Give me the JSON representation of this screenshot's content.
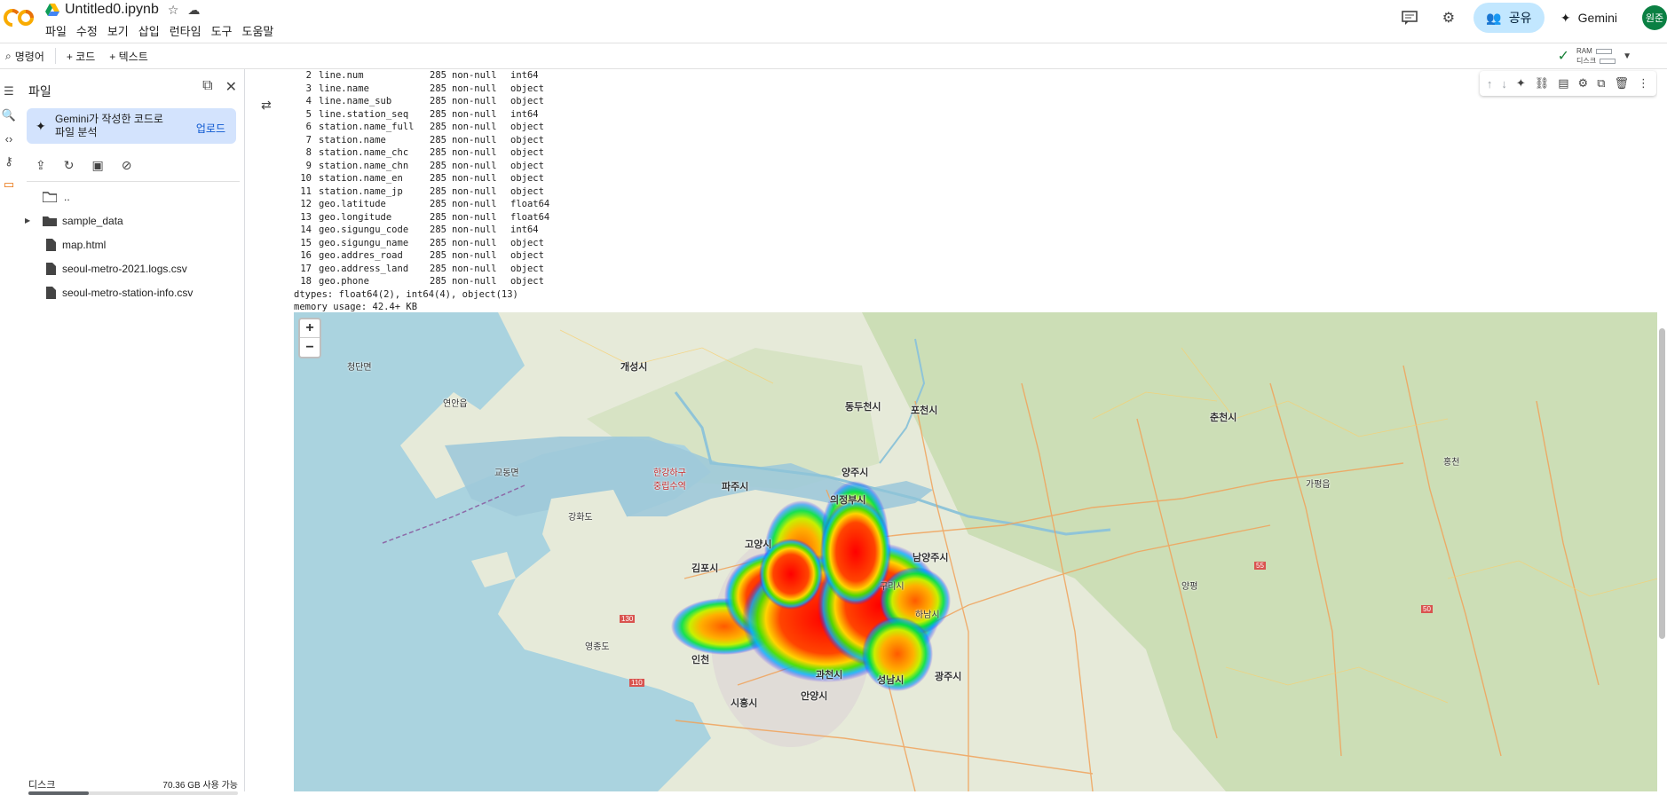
{
  "app": {
    "notebook_title": "Untitled0.ipynb",
    "menu": [
      "파일",
      "수정",
      "보기",
      "삽입",
      "런타임",
      "도구",
      "도움말"
    ],
    "share_label": "공유",
    "gemini_label": "Gemini",
    "avatar_text": "원준"
  },
  "toolbar": {
    "command_label": "명령어",
    "add_code_label": "+ 코드",
    "add_text_label": "+ 텍스트",
    "ram_label": "RAM",
    "disk_label": "디스크"
  },
  "sidebar": {
    "title": "파일",
    "gemini_card_text": "Gemini가 작성한 코드로 파일 분석",
    "gemini_card_action": "업로드",
    "tree": [
      {
        "label": "..",
        "type": "folder-up"
      },
      {
        "label": "sample_data",
        "type": "folder"
      },
      {
        "label": "map.html",
        "type": "file"
      },
      {
        "label": "seoul-metro-2021.logs.csv",
        "type": "file"
      },
      {
        "label": "seoul-metro-station-info.csv",
        "type": "file"
      }
    ],
    "disk_label": "디스크",
    "disk_value": "70.36 GB 사용 가능",
    "disk_used_fraction": 0.29
  },
  "output": {
    "rows": [
      [
        "2",
        "line.num",
        "285",
        "non-null",
        "int64"
      ],
      [
        "3",
        "line.name",
        "285",
        "non-null",
        "object"
      ],
      [
        "4",
        "line.name_sub",
        "285",
        "non-null",
        "object"
      ],
      [
        "5",
        "line.station_seq",
        "285",
        "non-null",
        "int64"
      ],
      [
        "6",
        "station.name_full",
        "285",
        "non-null",
        "object"
      ],
      [
        "7",
        "station.name",
        "285",
        "non-null",
        "object"
      ],
      [
        "8",
        "station.name_chc",
        "285",
        "non-null",
        "object"
      ],
      [
        "9",
        "station.name_chn",
        "285",
        "non-null",
        "object"
      ],
      [
        "10",
        "station.name_en",
        "285",
        "non-null",
        "object"
      ],
      [
        "11",
        "station.name_jp",
        "285",
        "non-null",
        "object"
      ],
      [
        "12",
        "geo.latitude",
        "285",
        "non-null",
        "float64"
      ],
      [
        "13",
        "geo.longitude",
        "285",
        "non-null",
        "float64"
      ],
      [
        "14",
        "geo.sigungu_code",
        "285",
        "non-null",
        "int64"
      ],
      [
        "15",
        "geo.sigungu_name",
        "285",
        "non-null",
        "object"
      ],
      [
        "16",
        "geo.addres_road",
        "285",
        "non-null",
        "object"
      ],
      [
        "17",
        "geo.address_land",
        "285",
        "non-null",
        "object"
      ],
      [
        "18",
        "geo.phone",
        "285",
        "non-null",
        "object"
      ]
    ],
    "dtypes_line": "dtypes: float64(2), int64(4), object(13)",
    "memory_line": "memory usage: 42.4+ KB"
  },
  "map": {
    "zoom_in": "+",
    "zoom_out": "−",
    "labels": [
      {
        "text": "개성시",
        "cls": "big"
      },
      {
        "text": "파주시",
        "cls": "big"
      },
      {
        "text": "고양시",
        "cls": "big"
      },
      {
        "text": "김포시",
        "cls": "big"
      },
      {
        "text": "인천",
        "cls": "big"
      },
      {
        "text": "의정부시",
        "cls": "big"
      },
      {
        "text": "양주시",
        "cls": "big"
      },
      {
        "text": "동두천시",
        "cls": "big"
      },
      {
        "text": "포천시",
        "cls": "big"
      },
      {
        "text": "남양주시",
        "cls": "big"
      },
      {
        "text": "춘천시",
        "cls": "big"
      },
      {
        "text": "광주시",
        "cls": "big"
      },
      {
        "text": "과천시",
        "cls": "big"
      },
      {
        "text": "안양시",
        "cls": "big"
      },
      {
        "text": "성남시",
        "cls": "big"
      },
      {
        "text": "시흥시",
        "cls": "big"
      },
      {
        "text": "강화도",
        "cls": ""
      },
      {
        "text": "교동면",
        "cls": ""
      },
      {
        "text": "영종도",
        "cls": ""
      },
      {
        "text": "한강하구\n중립수역",
        "cls": "red"
      },
      {
        "text": "연안읍",
        "cls": ""
      },
      {
        "text": "청단면",
        "cls": ""
      },
      {
        "text": "구리시",
        "cls": ""
      },
      {
        "text": "하남시",
        "cls": ""
      },
      {
        "text": "가평읍",
        "cls": ""
      },
      {
        "text": "홍천",
        "cls": ""
      },
      {
        "text": "양평",
        "cls": ""
      }
    ],
    "road_shields": [
      "130",
      "110",
      "55",
      "50"
    ]
  }
}
